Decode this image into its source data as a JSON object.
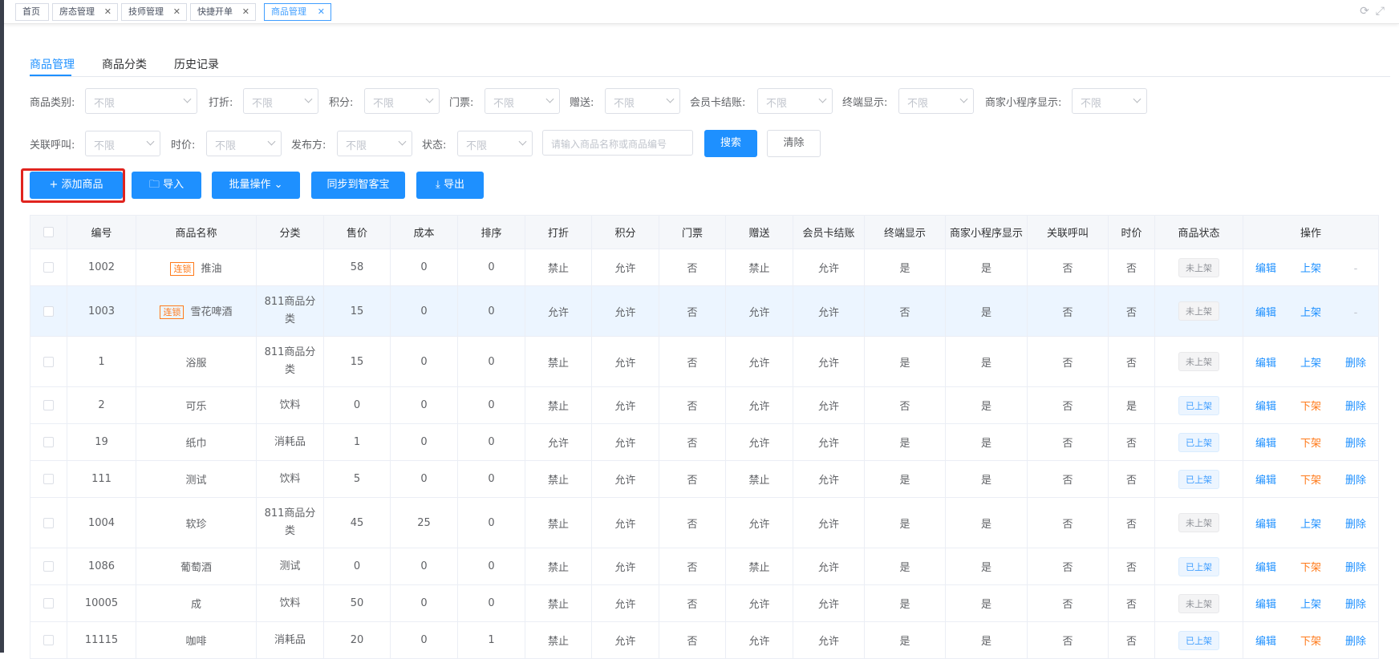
{
  "tabs": [
    {
      "label": "首页",
      "closable": false
    },
    {
      "label": "房态管理",
      "closable": true
    },
    {
      "label": "技师管理",
      "closable": true
    },
    {
      "label": "快捷开单",
      "closable": true
    },
    {
      "label": "商品管理",
      "closable": true,
      "active": true
    }
  ],
  "subtabs": [
    "商品管理",
    "商品分类",
    "历史记录"
  ],
  "filters": {
    "row1": [
      {
        "label": "商品类别:",
        "value": "不限"
      },
      {
        "label": "打折:",
        "value": "不限"
      },
      {
        "label": "积分:",
        "value": "不限"
      },
      {
        "label": "门票:",
        "value": "不限"
      },
      {
        "label": "赠送:",
        "value": "不限"
      },
      {
        "label": "会员卡结账:",
        "value": "不限"
      },
      {
        "label": "终端显示:",
        "value": "不限"
      },
      {
        "label": "商家小程序显示:",
        "value": "不限"
      }
    ],
    "row2": [
      {
        "label": "关联呼叫:",
        "value": "不限"
      },
      {
        "label": "时价:",
        "value": "不限"
      },
      {
        "label": "发布方:",
        "value": "不限"
      },
      {
        "label": "状态:",
        "value": "不限"
      }
    ],
    "search_placeholder": "请输入商品名称或商品编号",
    "search_label": "搜索",
    "clear_label": "清除"
  },
  "actions": {
    "add": "+ 添加商品",
    "import": "导入",
    "batch": "批量操作",
    "sync": "同步到智客宝",
    "export": "导出"
  },
  "table": {
    "headers": [
      "编号",
      "商品名称",
      "分类",
      "售价",
      "成本",
      "排序",
      "打折",
      "积分",
      "门票",
      "赠送",
      "会员卡结账",
      "终端显示",
      "商家小程序显示",
      "关联呼叫",
      "时价",
      "商品状态",
      "操作"
    ],
    "rows": [
      {
        "id": "1002",
        "locked": true,
        "name": "推油",
        "category": "",
        "price": "58",
        "cost": "0",
        "sort": "0",
        "discount": "禁止",
        "points": "允许",
        "ticket": "否",
        "gift": "禁止",
        "card": "允许",
        "terminal": "是",
        "mini": "是",
        "call": "否",
        "timeprice": "否",
        "status": "未上架",
        "edit": "编辑",
        "toggle": "上架",
        "delete": "-"
      },
      {
        "id": "1003",
        "locked": true,
        "name": "雪花啤酒",
        "category": "811商品分类",
        "price": "15",
        "cost": "0",
        "sort": "0",
        "discount": "允许",
        "points": "允许",
        "ticket": "否",
        "gift": "允许",
        "card": "允许",
        "terminal": "否",
        "mini": "是",
        "call": "否",
        "timeprice": "否",
        "status": "未上架",
        "edit": "编辑",
        "toggle": "上架",
        "delete": "-"
      },
      {
        "id": "1",
        "locked": false,
        "name": "浴服",
        "category": "811商品分类",
        "price": "15",
        "cost": "0",
        "sort": "0",
        "discount": "禁止",
        "points": "允许",
        "ticket": "否",
        "gift": "允许",
        "card": "允许",
        "terminal": "是",
        "mini": "是",
        "call": "否",
        "timeprice": "否",
        "status": "未上架",
        "edit": "编辑",
        "toggle": "上架",
        "delete": "删除"
      },
      {
        "id": "2",
        "locked": false,
        "name": "可乐",
        "category": "饮料",
        "price": "0",
        "cost": "0",
        "sort": "0",
        "discount": "禁止",
        "points": "允许",
        "ticket": "否",
        "gift": "允许",
        "card": "允许",
        "terminal": "否",
        "mini": "是",
        "call": "否",
        "timeprice": "是",
        "status": "已上架",
        "edit": "编辑",
        "toggle": "下架",
        "delete": "删除"
      },
      {
        "id": "19",
        "locked": false,
        "name": "纸巾",
        "category": "消耗品",
        "price": "1",
        "cost": "0",
        "sort": "0",
        "discount": "允许",
        "points": "允许",
        "ticket": "否",
        "gift": "允许",
        "card": "允许",
        "terminal": "是",
        "mini": "是",
        "call": "否",
        "timeprice": "否",
        "status": "已上架",
        "edit": "编辑",
        "toggle": "下架",
        "delete": "删除"
      },
      {
        "id": "111",
        "locked": false,
        "name": "测试",
        "category": "饮料",
        "price": "5",
        "cost": "0",
        "sort": "0",
        "discount": "禁止",
        "points": "允许",
        "ticket": "否",
        "gift": "禁止",
        "card": "允许",
        "terminal": "是",
        "mini": "是",
        "call": "否",
        "timeprice": "否",
        "status": "已上架",
        "edit": "编辑",
        "toggle": "下架",
        "delete": "删除"
      },
      {
        "id": "1004",
        "locked": false,
        "name": "软珍",
        "category": "811商品分类",
        "price": "45",
        "cost": "25",
        "sort": "0",
        "discount": "禁止",
        "points": "允许",
        "ticket": "否",
        "gift": "允许",
        "card": "允许",
        "terminal": "是",
        "mini": "是",
        "call": "否",
        "timeprice": "否",
        "status": "未上架",
        "edit": "编辑",
        "toggle": "上架",
        "delete": "删除"
      },
      {
        "id": "1086",
        "locked": false,
        "name": "葡萄酒",
        "category": "测试",
        "price": "0",
        "cost": "0",
        "sort": "0",
        "discount": "禁止",
        "points": "允许",
        "ticket": "否",
        "gift": "禁止",
        "card": "允许",
        "terminal": "是",
        "mini": "是",
        "call": "否",
        "timeprice": "否",
        "status": "已上架",
        "edit": "编辑",
        "toggle": "下架",
        "delete": "删除"
      },
      {
        "id": "10005",
        "locked": false,
        "name": "成",
        "category": "饮料",
        "price": "50",
        "cost": "0",
        "sort": "0",
        "discount": "禁止",
        "points": "允许",
        "ticket": "否",
        "gift": "允许",
        "card": "允许",
        "terminal": "是",
        "mini": "是",
        "call": "否",
        "timeprice": "否",
        "status": "未上架",
        "edit": "编辑",
        "toggle": "上架",
        "delete": "删除"
      },
      {
        "id": "11115",
        "locked": false,
        "name": "咖啡",
        "category": "消耗品",
        "price": "20",
        "cost": "0",
        "sort": "1",
        "discount": "禁止",
        "points": "允许",
        "ticket": "否",
        "gift": "允许",
        "card": "允许",
        "terminal": "是",
        "mini": "是",
        "call": "否",
        "timeprice": "否",
        "status": "已上架",
        "edit": "编辑",
        "toggle": "下架",
        "delete": "删除"
      }
    ]
  },
  "colors": {
    "primary": "#1e90ff",
    "orange": "#ff7a1a",
    "highlight": "#e0241f"
  }
}
